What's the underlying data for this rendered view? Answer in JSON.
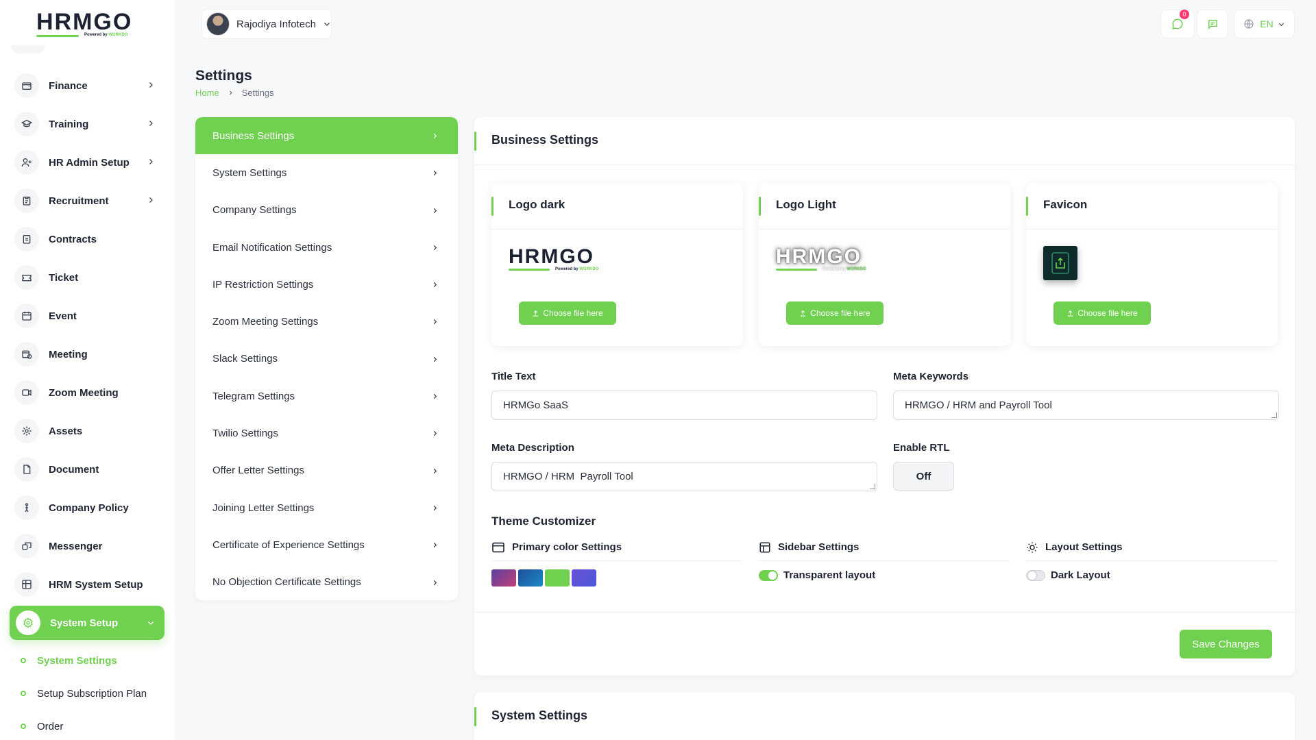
{
  "brand": {
    "logo_text": "HRMGO",
    "powered_prefix": "Powered by",
    "powered_name": "WORKDO"
  },
  "sidebar": {
    "items": [
      {
        "label": "Finance",
        "icon": "wallet-icon",
        "has_children": true
      },
      {
        "label": "Training",
        "icon": "graduation-cap-icon",
        "has_children": true
      },
      {
        "label": "HR Admin Setup",
        "icon": "user-plus-icon",
        "has_children": true
      },
      {
        "label": "Recruitment",
        "icon": "clipboard-icon",
        "has_children": true
      },
      {
        "label": "Contracts",
        "icon": "contract-icon",
        "has_children": false
      },
      {
        "label": "Ticket",
        "icon": "ticket-icon",
        "has_children": false
      },
      {
        "label": "Event",
        "icon": "calendar-icon",
        "has_children": false
      },
      {
        "label": "Meeting",
        "icon": "calendar-clock-icon",
        "has_children": false
      },
      {
        "label": "Zoom Meeting",
        "icon": "video-icon",
        "has_children": false
      },
      {
        "label": "Assets",
        "icon": "asset-icon",
        "has_children": false
      },
      {
        "label": "Document",
        "icon": "document-icon",
        "has_children": false
      },
      {
        "label": "Company Policy",
        "icon": "policy-icon",
        "has_children": false
      },
      {
        "label": "Messenger",
        "icon": "messenger-icon",
        "has_children": false
      },
      {
        "label": "HRM System Setup",
        "icon": "grid-icon",
        "has_children": false
      },
      {
        "label": "System Setup",
        "icon": "gear-icon",
        "has_children": true,
        "active": true
      }
    ],
    "sub_items": [
      {
        "label": "System Settings",
        "active": true
      },
      {
        "label": "Setup Subscription Plan"
      },
      {
        "label": "Order"
      }
    ]
  },
  "header": {
    "company_name": "Rajodiya Infotech",
    "notification_count": "0",
    "language": "EN"
  },
  "page": {
    "title": "Settings",
    "breadcrumb": [
      "Home",
      "Settings"
    ]
  },
  "settings_menu": [
    {
      "label": "Business Settings",
      "active": true
    },
    {
      "label": "System Settings"
    },
    {
      "label": "Company Settings"
    },
    {
      "label": "Email Notification Settings"
    },
    {
      "label": "IP Restriction Settings"
    },
    {
      "label": "Zoom Meeting Settings"
    },
    {
      "label": "Slack Settings"
    },
    {
      "label": "Telegram Settings"
    },
    {
      "label": "Twilio Settings"
    },
    {
      "label": "Offer Letter Settings"
    },
    {
      "label": "Joining Letter Settings"
    },
    {
      "label": "Certificate of Experience Settings"
    },
    {
      "label": "No Objection Certificate Settings"
    }
  ],
  "business_settings": {
    "title": "Business Settings",
    "logo_cards": [
      {
        "title": "Logo dark",
        "button": "Choose file here"
      },
      {
        "title": "Logo Light",
        "button": "Choose file here"
      },
      {
        "title": "Favicon",
        "button": "Choose file here"
      }
    ],
    "title_text": {
      "label": "Title Text",
      "value": "HRMGo SaaS"
    },
    "meta_keywords": {
      "label": "Meta Keywords",
      "value": "HRMGO / HRM and Payroll Tool"
    },
    "meta_description": {
      "label": "Meta Description",
      "value": "HRMGO / HRM  Payroll Tool"
    },
    "enable_rtl": {
      "label": "Enable RTL",
      "value": "Off"
    },
    "theme": {
      "title": "Theme Customizer",
      "primary_color": {
        "label": "Primary color Settings",
        "swatches": [
          "#7b3fa0",
          "#1f6fb3",
          "#6fd14f",
          "#5b4fd6"
        ]
      },
      "sidebar": {
        "label": "Sidebar Settings",
        "option": "Transparent layout",
        "enabled": true
      },
      "layout": {
        "label": "Layout Settings",
        "option": "Dark Layout",
        "enabled": false
      }
    },
    "save_button": "Save Changes"
  },
  "system_settings_card": {
    "title": "System Settings"
  },
  "colors": {
    "accent": "#6fd14f",
    "badge": "#ff3a6e"
  }
}
